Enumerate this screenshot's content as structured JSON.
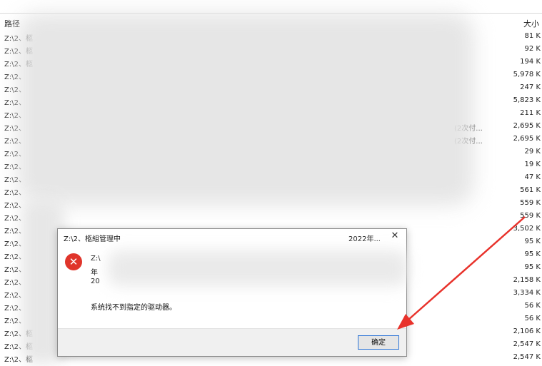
{
  "header": {
    "path_label": "路径",
    "size_label": "大小"
  },
  "rows": [
    {
      "path": "Z:\\2、柩",
      "note": "",
      "size": "81 K"
    },
    {
      "path": "Z:\\2、柩",
      "note": "",
      "size": "92 K"
    },
    {
      "path": "Z:\\2、柩",
      "note": "",
      "size": "194 K"
    },
    {
      "path": "Z:\\2、",
      "note": "",
      "size": "5,978 K"
    },
    {
      "path": "Z:\\2、",
      "note": "",
      "size": "247 K"
    },
    {
      "path": "Z:\\2、",
      "note": "",
      "size": "5,823 K"
    },
    {
      "path": "Z:\\2、",
      "note": "",
      "size": "211 K"
    },
    {
      "path": "Z:\\2、",
      "note": "(2次付...",
      "size": "2,695 K"
    },
    {
      "path": "Z:\\2、",
      "note": "(2次付...",
      "size": "2,695 K"
    },
    {
      "path": "Z:\\2、",
      "note": "",
      "size": "29 K"
    },
    {
      "path": "Z:\\2、",
      "note": "",
      "size": "19 K"
    },
    {
      "path": "Z:\\2、",
      "note": "",
      "size": "47 K"
    },
    {
      "path": "Z:\\2、",
      "note": "",
      "size": "561 K"
    },
    {
      "path": "Z:\\2、",
      "note": "",
      "size": "559 K"
    },
    {
      "path": "Z:\\2、",
      "note": "",
      "size": "559 K"
    },
    {
      "path": "Z:\\2、",
      "note": "",
      "size": "3,502 K"
    },
    {
      "path": "Z:\\2、",
      "note": "",
      "size": "95 K"
    },
    {
      "path": "Z:\\2、",
      "note": "",
      "size": "95 K"
    },
    {
      "path": "Z:\\2、",
      "note": "",
      "size": "95 K"
    },
    {
      "path": "Z:\\2、",
      "note": "",
      "size": "2,158 K"
    },
    {
      "path": "Z:\\2、",
      "note": "",
      "size": "3,334 K"
    },
    {
      "path": "Z:\\2、",
      "note": "",
      "size": "56 K"
    },
    {
      "path": "Z:\\2、",
      "note": "",
      "size": "56 K"
    },
    {
      "path": "Z:\\2、柩",
      "note": "",
      "size": "2,106 K"
    },
    {
      "path": "Z:\\2、柩",
      "note": "",
      "size": "2,547 K"
    },
    {
      "path": "Z:\\2、柩",
      "note": "",
      "size": "2,547 K"
    }
  ],
  "dialog": {
    "title": "Z:\\2、柩組管理中",
    "title_right": "2022年...",
    "close_symbol": "✕",
    "error_symbol": "✕",
    "msg_line1": "Z:\\",
    "msg_line2": "年",
    "msg_line3": "20",
    "message": "系统找不到指定的驱动器。",
    "ok_label": "确定"
  },
  "colors": {
    "accent": "#2b73d6",
    "error": "#e0352b",
    "arrow": "#e8322b"
  }
}
